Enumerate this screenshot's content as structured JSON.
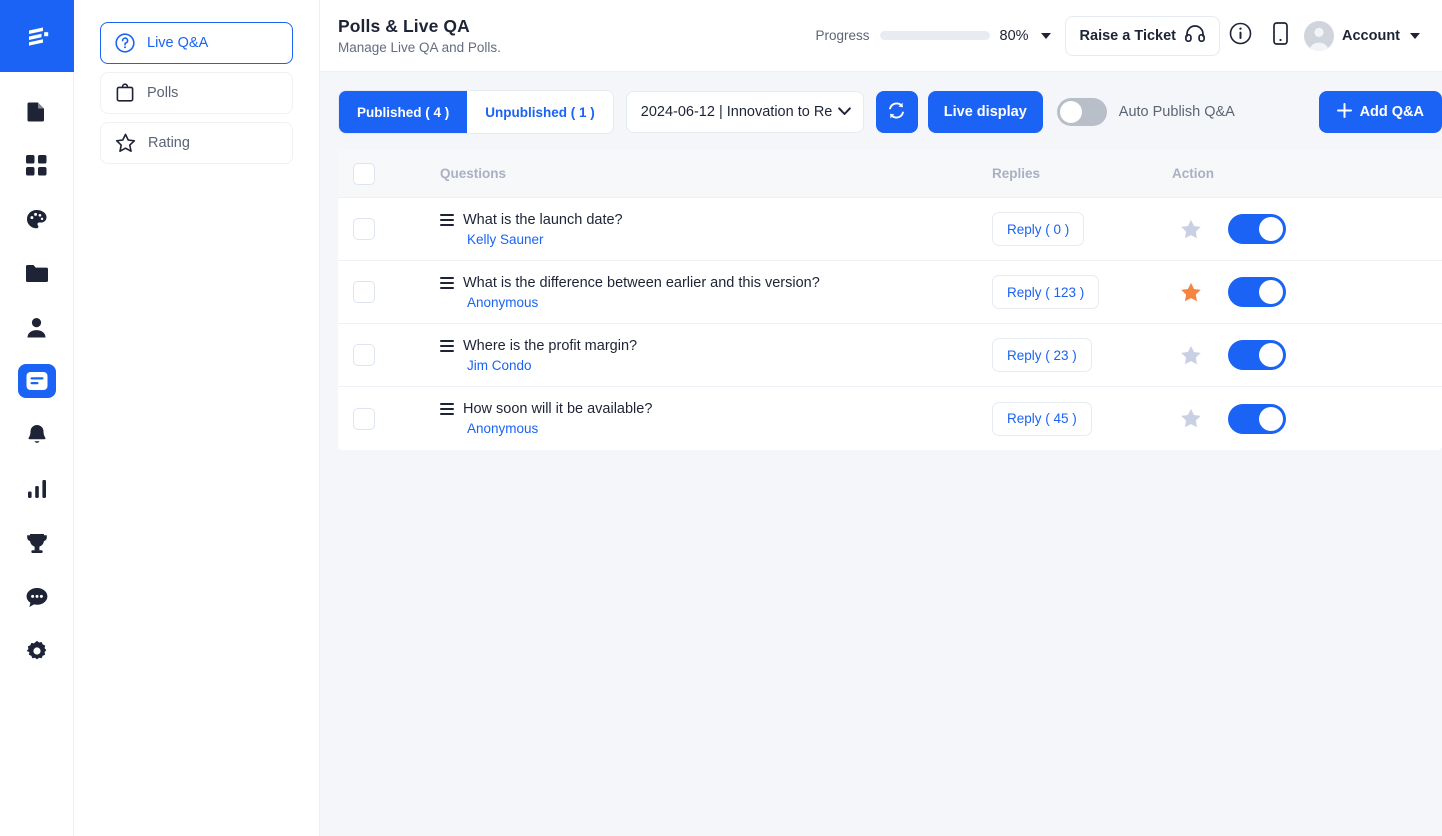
{
  "brand": {
    "logo_icon": "stacked-bars-logo",
    "accent": "#1a63f5"
  },
  "header": {
    "title": "Polls & Live QA",
    "subtitle": "Manage Live QA and Polls.",
    "progress_label": "Progress",
    "progress_percent": "80%",
    "progress_value": 80,
    "ticket_button": "Raise a Ticket",
    "ticket_icon": "headset-icon",
    "info_icon": "info-circle-icon",
    "mobile_icon": "mobile-phone-icon",
    "account_name": "Account",
    "avatar_icon": "user-avatar-icon",
    "caret_icon": "chevron-down-icon"
  },
  "rail": {
    "items": [
      {
        "name": "document",
        "icon": "document-icon",
        "active": false
      },
      {
        "name": "dashboard",
        "icon": "grid-squares-icon",
        "active": false
      },
      {
        "name": "design",
        "icon": "palette-icon",
        "active": false
      },
      {
        "name": "files",
        "icon": "folder-icon",
        "active": false
      },
      {
        "name": "attendees",
        "icon": "person-icon",
        "active": false
      },
      {
        "name": "polls-qa",
        "icon": "speech-lines-icon",
        "active": true
      },
      {
        "name": "notifications",
        "icon": "bell-icon",
        "active": false
      },
      {
        "name": "analytics",
        "icon": "bar-chart-icon",
        "active": false
      },
      {
        "name": "leaderboard",
        "icon": "trophy-icon",
        "active": false
      },
      {
        "name": "chat",
        "icon": "chat-bubble-icon",
        "active": false
      },
      {
        "name": "settings",
        "icon": "gear-icon",
        "active": false
      }
    ]
  },
  "subnav": {
    "items": [
      {
        "label": "Live Q&A",
        "icon": "question-circle-icon",
        "active": true
      },
      {
        "label": "Polls",
        "icon": "clipboard-icon",
        "active": false
      },
      {
        "label": "Rating",
        "icon": "star-outline-icon",
        "active": false
      }
    ]
  },
  "toolbar": {
    "tab_published": "Published ( 4 )",
    "tab_unpublished": "Unpublished ( 1 )",
    "session_select": "2024-06-12 | Innovation to Re",
    "refresh_icon": "refresh-icon",
    "live_display": "Live display",
    "auto_publish_label": "Auto Publish Q&A",
    "auto_publish_on": false,
    "add_button": "Add Q&A",
    "add_icon": "plus-icon"
  },
  "table": {
    "columns": {
      "questions": "Questions",
      "replies": "Replies",
      "action": "Action"
    },
    "rows": [
      {
        "question": "What is the launch date?",
        "author": "Kelly Sauner",
        "reply": "Reply ( 0 )",
        "starred": false,
        "published": true
      },
      {
        "question": "What is the difference between earlier and this version?",
        "author": "Anonymous",
        "reply": "Reply ( 123 )",
        "starred": true,
        "published": true
      },
      {
        "question": "Where is the profit margin?",
        "author": "Jim Condo",
        "reply": "Reply ( 23 )",
        "starred": false,
        "published": true
      },
      {
        "question": "How soon will it be available?",
        "author": "Anonymous",
        "reply": "Reply ( 45 )",
        "starred": false,
        "published": true
      }
    ]
  },
  "colors": {
    "star_active": "#f58442",
    "star_inactive": "#c9d0e3",
    "toggle_on": "#1a63f5",
    "toggle_off": "#b9bfc9"
  }
}
